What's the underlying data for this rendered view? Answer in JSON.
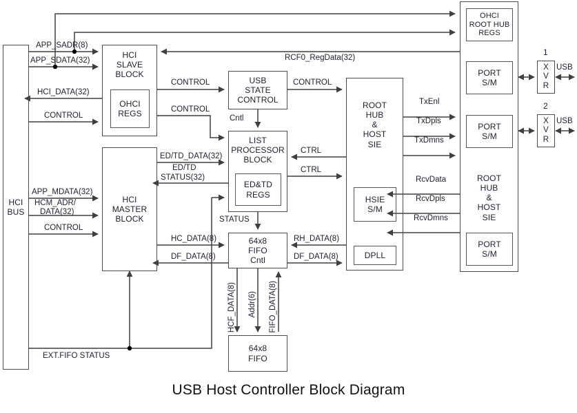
{
  "title": "USB Host Controller Block Diagram",
  "colors": {
    "line": "#3f3f3f",
    "box_border": "#4a4a4a",
    "text": "#241a2e",
    "background": "#ffffff"
  },
  "blocks": {
    "hci_bus": {
      "lines": [
        "HCI",
        "BUS"
      ]
    },
    "hci_slave": {
      "lines": [
        "HCI",
        "SLAVE",
        "BLOCK"
      ]
    },
    "ohci_regs": {
      "lines": [
        "OHCI",
        "REGS"
      ]
    },
    "hci_master": {
      "lines": [
        "HCI",
        "MASTER",
        "BLOCK"
      ]
    },
    "usb_state_control": {
      "lines": [
        "USB",
        "STATE",
        "CONTROL"
      ]
    },
    "list_processor": {
      "lines": [
        "LIST",
        "PROCESSOR",
        "BLOCK"
      ]
    },
    "ed_td_regs": {
      "lines": [
        "ED&TD",
        "REGS"
      ]
    },
    "fifo_cntl": {
      "lines": [
        "64x8",
        "FIFO",
        "Cntl"
      ]
    },
    "fifo": {
      "lines": [
        "64x8",
        "FIFO"
      ]
    },
    "root_hub_host_sie_mid": {
      "lines": [
        "ROOT",
        "HUB",
        "&",
        "HOST",
        "SIE"
      ]
    },
    "hsie_sm": {
      "lines": [
        "HSIE",
        "S/M"
      ]
    },
    "dpll": {
      "lines": [
        "DPLL"
      ]
    },
    "root_hub_host_sie_right": {
      "lines": [
        "ROOT",
        "HUB",
        "&",
        "HOST",
        "SIE"
      ]
    },
    "ohci_root_hub_regs": {
      "lines": [
        "OHCI",
        "ROOT HUB",
        "REGS"
      ]
    },
    "port_sm_1": {
      "lines": [
        "PORT",
        "S/M"
      ]
    },
    "port_sm_2": {
      "lines": [
        "PORT",
        "S/M"
      ]
    },
    "port_sm_3": {
      "lines": [
        "PORT",
        "S/M"
      ]
    },
    "xvr_1": {
      "lines": [
        "X",
        "V",
        "R"
      ]
    },
    "xvr_2": {
      "lines": [
        "X",
        "V",
        "R"
      ]
    }
  },
  "signals": {
    "app_sadr": "APP_SADR(8)",
    "app_sdata": "APP_SDATA(32)",
    "hci_data": "HCI_DATA(32)",
    "control_bus_slave": "CONTROL",
    "control_slave_usbstate": "CONTROL",
    "control_slave_list": "CONTROL",
    "rcf0_regdata": "RCF0_RegData(32)",
    "control_usbstate_roothub": "CONTROL",
    "cntl": "Cntl",
    "ed_td_data": "ED/TD_DATA(32)",
    "ed_td_status_l1": "ED/TD",
    "ed_td_status_l2": "STATUS(32)",
    "app_mdata": "APP_MDATA(32)",
    "hcm_adr_l1": "HCM_ADR/",
    "hcm_adr_l2": "DATA(32)",
    "control_bus_master": "CONTROL",
    "ctrl_up": "CTRL",
    "ctrl_down": "CTRL",
    "status": "STATUS",
    "hc_data": "HC_DATA(8)",
    "df_data_master": "DF_DATA(8)",
    "rh_data": "RH_DATA(8)",
    "df_data_roothub": "DF_DATA(8)",
    "hcf_data": "HCF_DATA(8)",
    "addr6": "Addr(6)",
    "fifo_data": "FIFO_DATA(8)",
    "ext_fifo_status": "EXT.FIFO STATUS",
    "tx_enl": "TxEnl",
    "tx_dpls": "TxDpls",
    "tx_dmns": "TxDmns",
    "rcv_data": "RcvData",
    "rcv_dpls": "RcvDpls",
    "rcv_dmns": "RcvDmns",
    "port_num_1": "1",
    "port_num_2": "2",
    "usb_1": "USB",
    "usb_2": "USB"
  }
}
